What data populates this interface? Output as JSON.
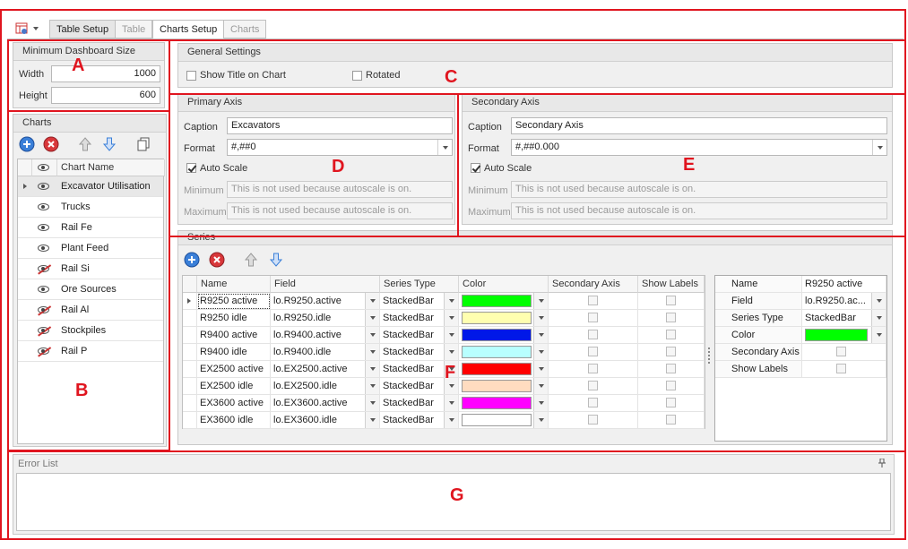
{
  "tabs": [
    {
      "label": "Table Setup",
      "state": "normal"
    },
    {
      "label": "Table",
      "state": "disabled"
    },
    {
      "label": "Charts Setup",
      "state": "active"
    },
    {
      "label": "Charts",
      "state": "disabled"
    }
  ],
  "min_dashboard": {
    "title": "Minimum Dashboard Size",
    "width_label": "Width",
    "width_value": "1000",
    "height_label": "Height",
    "height_value": "600"
  },
  "charts": {
    "title": "Charts",
    "column_header": "Chart Name",
    "items": [
      {
        "name": "Excavator Utilisation",
        "visible": true,
        "selected": true
      },
      {
        "name": "Trucks",
        "visible": true
      },
      {
        "name": "Rail Fe",
        "visible": true
      },
      {
        "name": "Plant Feed",
        "visible": true
      },
      {
        "name": "Rail Si",
        "visible": false
      },
      {
        "name": "Ore Sources",
        "visible": true
      },
      {
        "name": "Rail Al",
        "visible": false
      },
      {
        "name": "Stockpiles",
        "visible": false
      },
      {
        "name": "Rail P",
        "visible": false
      }
    ]
  },
  "general": {
    "title": "General Settings",
    "show_title": "Show Title on Chart",
    "rotated": "Rotated"
  },
  "primary": {
    "title": "Primary Axis",
    "caption_label": "Caption",
    "caption_value": "Excavators",
    "format_label": "Format",
    "format_value": "#,##0",
    "auto_scale": "Auto Scale",
    "min_label": "Minimum",
    "min_value": "This is not used because autoscale is on.",
    "max_label": "Maximum",
    "max_value": "This is not used because autoscale is on."
  },
  "secondary": {
    "title": "Secondary Axis",
    "caption_label": "Caption",
    "caption_value": "Secondary Axis",
    "format_label": "Format",
    "format_value": "#,##0.000",
    "auto_scale": "Auto Scale",
    "min_label": "Minimum",
    "min_value": "This is not used because autoscale is on.",
    "max_label": "Maximum",
    "max_value": "This is not used because autoscale is on."
  },
  "series": {
    "title": "Series",
    "headers": [
      "Name",
      "Field",
      "Series Type",
      "Color",
      "Secondary Axis",
      "Show Labels"
    ],
    "rows": [
      {
        "name": "R9250 active",
        "field": "lo.R9250.active",
        "type": "StackedBar",
        "color": "#00ff00"
      },
      {
        "name": "R9250 idle",
        "field": "lo.R9250.idle",
        "type": "StackedBar",
        "color": "#ffffb0"
      },
      {
        "name": "R9400 active",
        "field": "lo.R9400.active",
        "type": "StackedBar",
        "color": "#0018e8"
      },
      {
        "name": "R9400 idle",
        "field": "lo.R9400.idle",
        "type": "StackedBar",
        "color": "#b8ffff"
      },
      {
        "name": "EX2500 active",
        "field": "lo.EX2500.active",
        "type": "StackedBar",
        "color": "#ff0000"
      },
      {
        "name": "EX2500 idle",
        "field": "lo.EX2500.idle",
        "type": "StackedBar",
        "color": "#ffdcc0"
      },
      {
        "name": "EX3600 active",
        "field": "lo.EX3600.active",
        "type": "StackedBar",
        "color": "#ff00ff"
      },
      {
        "name": "EX3600 idle",
        "field": "lo.EX3600.idle",
        "type": "StackedBar",
        "color": "#ffffff"
      }
    ]
  },
  "props": {
    "rows": [
      {
        "label": "Name",
        "value": "R9250 active"
      },
      {
        "label": "Field",
        "value": "lo.R9250.ac..."
      },
      {
        "label": "Series Type",
        "value": "StackedBar"
      },
      {
        "label": "Color",
        "value": ""
      },
      {
        "label": "Secondary Axis",
        "value": ""
      },
      {
        "label": "Show Labels",
        "value": ""
      }
    ],
    "color": "#00ff00"
  },
  "error_list": {
    "title": "Error List",
    "pin_icon": "pin-icon"
  },
  "annotations": [
    "A",
    "B",
    "C",
    "D",
    "E",
    "F",
    "G"
  ],
  "colors": {
    "annotation": "#e0151f",
    "panel_bg": "#f0f0f0",
    "selected_row": "#e8e8e8"
  }
}
